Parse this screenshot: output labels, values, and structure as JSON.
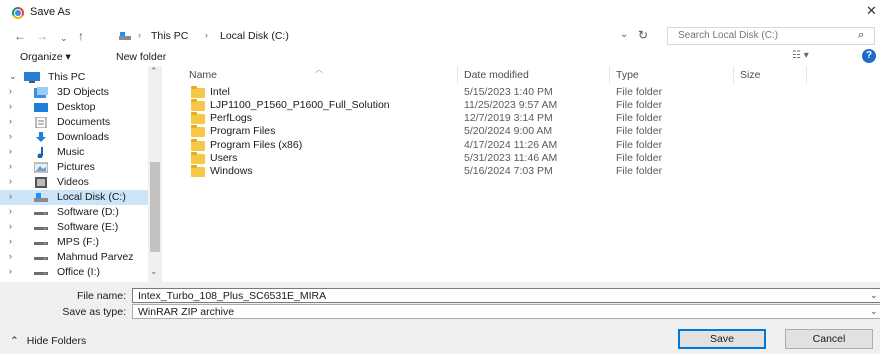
{
  "window": {
    "title": "Save As",
    "close_symbol": "✕"
  },
  "nav": {
    "breadcrumb": [
      "This PC",
      "Local Disk (C:)"
    ],
    "search_placeholder": "Search Local Disk (C:)"
  },
  "toolbar": {
    "organize_label": "Organize ▾",
    "new_folder_label": "New folder"
  },
  "sidebar": {
    "items": [
      {
        "label": "This PC",
        "icon": "monitor-icon",
        "caret": "⌄"
      },
      {
        "label": "3D Objects",
        "icon": "3d-objects-icon",
        "caret": "›"
      },
      {
        "label": "Desktop",
        "icon": "desktop-icon",
        "caret": "›"
      },
      {
        "label": "Documents",
        "icon": "documents-icon",
        "caret": "›"
      },
      {
        "label": "Downloads",
        "icon": "downloads-icon",
        "caret": "›"
      },
      {
        "label": "Music",
        "icon": "music-icon",
        "caret": "›"
      },
      {
        "label": "Pictures",
        "icon": "pictures-icon",
        "caret": "›"
      },
      {
        "label": "Videos",
        "icon": "videos-icon",
        "caret": "›"
      },
      {
        "label": "Local Disk (C:)",
        "icon": "drive-c-icon",
        "caret": "›",
        "selected": true
      },
      {
        "label": "Software (D:)",
        "icon": "drive-icon",
        "caret": "›"
      },
      {
        "label": "Software (E:)",
        "icon": "drive-icon",
        "caret": "›"
      },
      {
        "label": "MPS (F:)",
        "icon": "drive-icon",
        "caret": "›"
      },
      {
        "label": "Mahmud Parvez",
        "icon": "drive-icon",
        "caret": "›"
      },
      {
        "label": "Office (I:)",
        "icon": "drive-icon",
        "caret": "›"
      }
    ]
  },
  "file_list": {
    "columns": [
      "Name",
      "Date modified",
      "Type",
      "Size"
    ],
    "rows": [
      {
        "name": "Intel",
        "date": "5/15/2023 1:40 PM",
        "type": "File folder"
      },
      {
        "name": "LJP1100_P1560_P1600_Full_Solution",
        "date": "11/25/2023 9:57 AM",
        "type": "File folder"
      },
      {
        "name": "PerfLogs",
        "date": "12/7/2019 3:14 PM",
        "type": "File folder"
      },
      {
        "name": "Program Files",
        "date": "5/20/2024 9:00 AM",
        "type": "File folder"
      },
      {
        "name": "Program Files (x86)",
        "date": "4/17/2024 11:26 AM",
        "type": "File folder"
      },
      {
        "name": "Users",
        "date": "5/31/2023 11:46 AM",
        "type": "File folder"
      },
      {
        "name": "Windows",
        "date": "5/16/2024 7:03 PM",
        "type": "File folder"
      }
    ]
  },
  "save": {
    "file_name_label": "File name:",
    "file_name_value": "Intex_Turbo_108_Plus_SC6531E_MIRA",
    "save_type_label": "Save as type:",
    "save_type_value": "WinRAR ZIP archive",
    "hide_folders_label": "Hide Folders",
    "save_button": "Save",
    "cancel_button": "Cancel"
  },
  "colors": {
    "selection": "#cce4f7",
    "accent": "#0078d7",
    "folder": "#f7c748"
  }
}
